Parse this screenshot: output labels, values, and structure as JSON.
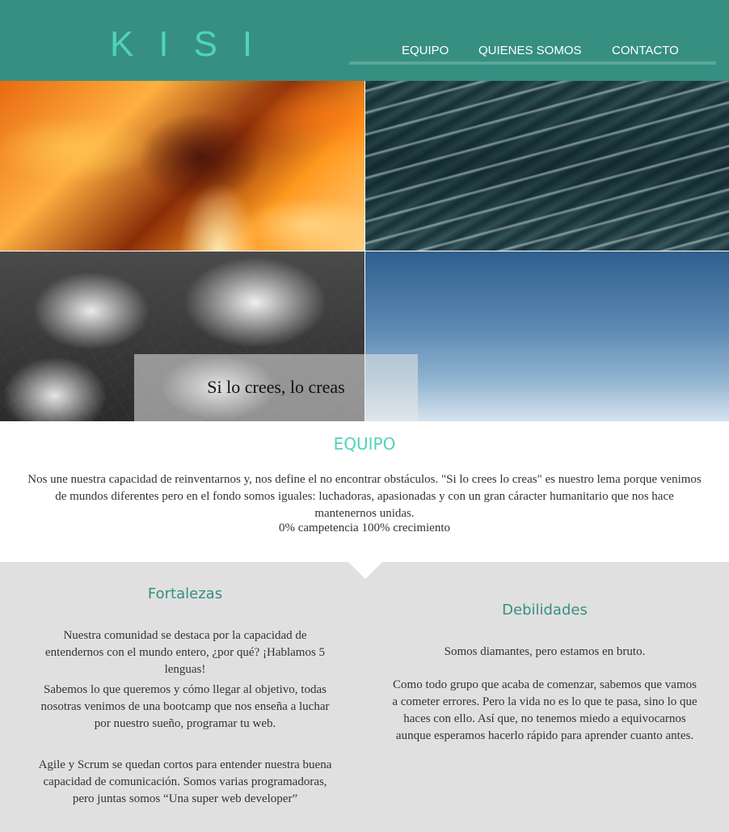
{
  "header": {
    "logo": "KISI",
    "nav": [
      {
        "label": "EQUIPO"
      },
      {
        "label": "QUIENES SOMOS"
      },
      {
        "label": "CONTACTO"
      }
    ]
  },
  "hero": {
    "slogan": "Si lo crees, lo creas"
  },
  "equipo": {
    "title": "EQUIPO",
    "text": "Nos une nuestra capacidad de reinventarnos y, nos define el no encontrar obstáculos. \"Si lo crees lo creas\" es nuestro lema porque venimos de mundos diferentes pero en el fondo somos iguales: luchadoras, apasionadas y con un gran cáracter humanitario que nos hace mantenernos unidas.",
    "motto": "0% campetencia 100% crecimiento"
  },
  "fortalezas": {
    "title": "Fortalezas",
    "paragraphs": [
      "Nuestra comunidad se destaca por la capacidad de entendernos con el mundo entero, ¿por qué? ¡Hablamos 5 lenguas!",
      "Sabemos lo que queremos y cómo llegar al objetivo, todas nosotras venimos de una bootcamp que nos enseña a luchar por nuestro sueño, programar tu web.",
      "Agile y Scrum se quedan cortos para entender nuestra buena capacidad de comunicación. Somos varias programadoras, pero juntas somos “Una super web developer”"
    ]
  },
  "debilidades": {
    "title": "Debilidades",
    "paragraphs": [
      "Somos diamantes, pero estamos en bruto.",
      "Como todo grupo que acaba de comenzar, sabemos que vamos a cometer errores. Pero la vida no es lo que te pasa, sino lo que haces con ello. Así que, no tenemos miedo a equivocarnos aunque esperamos hacerlo rápido para aprender cuanto antes."
    ]
  },
  "colors": {
    "header_bg": "#368f80",
    "accent": "#4fd3bc",
    "section_bg": "#e0e0e0"
  }
}
